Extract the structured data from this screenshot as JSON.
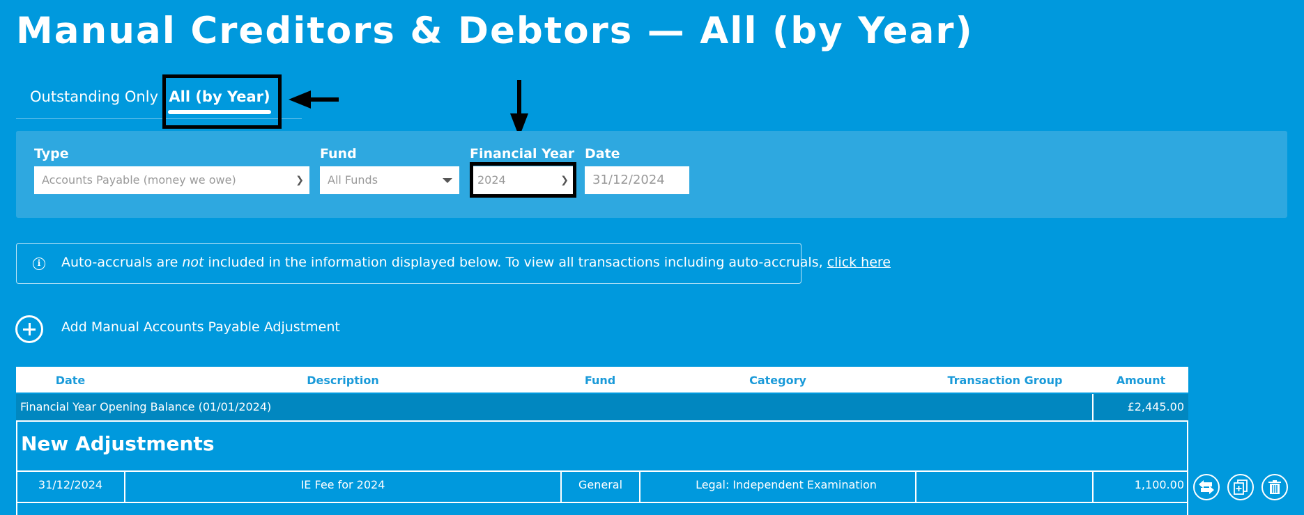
{
  "page": {
    "title": "Manual Creditors & Debtors — All (by Year)"
  },
  "tabs": [
    {
      "label": "Outstanding Only",
      "active": false
    },
    {
      "label": "All (by Year)",
      "active": true
    }
  ],
  "filters": {
    "type": {
      "label": "Type",
      "value": "Accounts Payable (money we owe)"
    },
    "fund": {
      "label": "Fund",
      "value": "All Funds"
    },
    "financial_year": {
      "label": "Financial Year",
      "value": "2024"
    },
    "date": {
      "label": "Date",
      "value": "31/12/2024"
    }
  },
  "info": {
    "text_before": "Auto-accruals are ",
    "emphasis": "not",
    "text_after": " included in the information displayed below. To view all transactions including auto-accruals, ",
    "link_label": "click here"
  },
  "add_action": {
    "label": "Add Manual Accounts Payable Adjustment"
  },
  "table": {
    "columns": [
      "Date",
      "Description",
      "Fund",
      "Category",
      "Transaction Group",
      "Amount"
    ],
    "opening_balance": {
      "label": "Financial Year Opening Balance (01/01/2024)",
      "amount": "£2,445.00"
    },
    "section_title": "New Adjustments",
    "rows": [
      {
        "date": "31/12/2024",
        "description": "IE Fee for 2024",
        "fund": "General",
        "category": "Legal: Independent Examination",
        "transaction_group": "",
        "amount": "1,100.00"
      }
    ]
  },
  "row_actions": [
    "swap-icon",
    "duplicate-icon",
    "trash-icon"
  ],
  "colors": {
    "background": "#0099dd",
    "panel": "#2ea8e0",
    "opening_row": "#0187c0",
    "header_text": "#1a9ad9"
  }
}
